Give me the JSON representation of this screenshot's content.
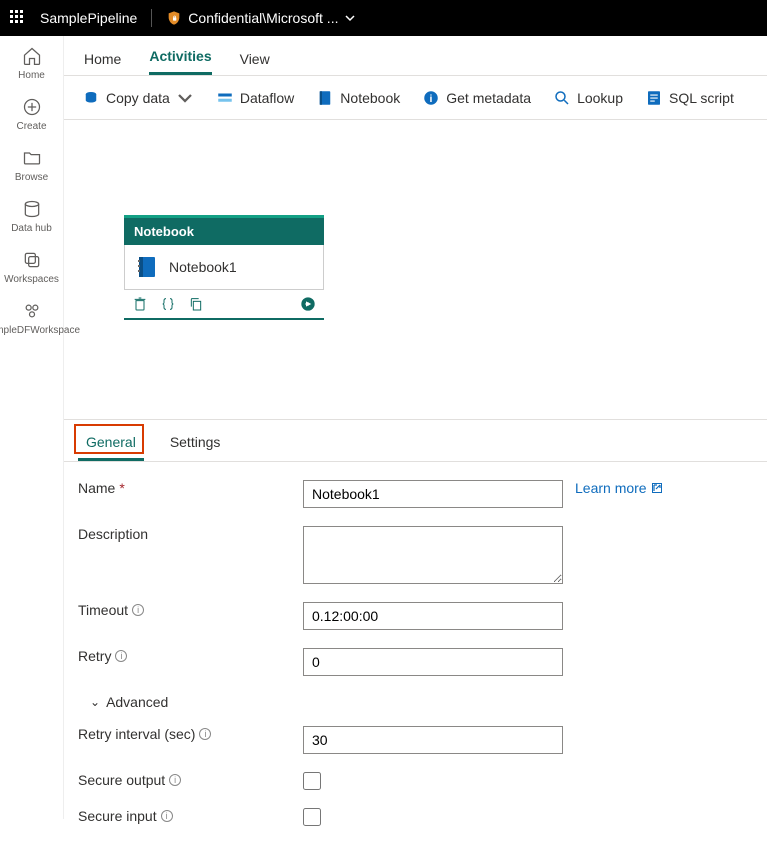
{
  "topbar": {
    "pipeline_name": "SamplePipeline",
    "sensitivity_label": "Confidential\\Microsoft ..."
  },
  "leftrail": {
    "home": "Home",
    "create": "Create",
    "browse": "Browse",
    "datahub": "Data hub",
    "workspaces": "Workspaces",
    "sample_ws": "SampleDFWorkspace"
  },
  "page_tabs": {
    "home": "Home",
    "activities": "Activities",
    "view": "View"
  },
  "ribbon": {
    "copy_data": "Copy data",
    "dataflow": "Dataflow",
    "notebook": "Notebook",
    "get_metadata": "Get metadata",
    "lookup": "Lookup",
    "sql_script": "SQL script"
  },
  "activity": {
    "type_label": "Notebook",
    "name": "Notebook1"
  },
  "prop_tabs": {
    "general": "General",
    "settings": "Settings"
  },
  "form": {
    "name_label": "Name",
    "name_value": "Notebook1",
    "learn_more": "Learn more",
    "description_label": "Description",
    "description_value": "",
    "timeout_label": "Timeout",
    "timeout_value": "0.12:00:00",
    "retry_label": "Retry",
    "retry_value": "0",
    "advanced_label": "Advanced",
    "retry_interval_label": "Retry interval (sec)",
    "retry_interval_value": "30",
    "secure_output_label": "Secure output",
    "secure_input_label": "Secure input"
  }
}
